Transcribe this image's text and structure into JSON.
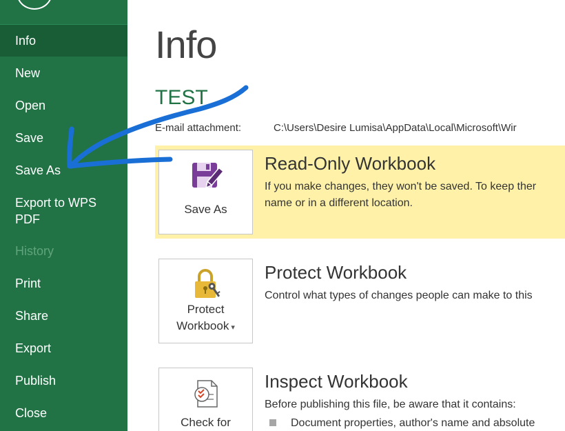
{
  "sidebar": {
    "items": [
      {
        "label": "Info",
        "state": "active"
      },
      {
        "label": "New"
      },
      {
        "label": "Open"
      },
      {
        "label": "Save"
      },
      {
        "label": "Save As"
      },
      {
        "label": "Export to WPS\nPDF"
      },
      {
        "label": "History",
        "state": "disabled"
      },
      {
        "label": "Print"
      },
      {
        "label": "Share"
      },
      {
        "label": "Export"
      },
      {
        "label": "Publish"
      },
      {
        "label": "Close"
      }
    ]
  },
  "main": {
    "title": "Info",
    "document_name": "TEST",
    "attachment": {
      "label": "E-mail attachment:",
      "path": "C:\\Users\\Desire Lumisa\\AppData\\Local\\Microsoft\\Wir"
    },
    "sections": [
      {
        "tile_label": "Save As",
        "icon": "save-as-icon",
        "heading": "Read-Only Workbook",
        "description_lines": [
          "If you make changes, they won't be saved. To keep ther",
          "name or in a different location."
        ]
      },
      {
        "tile_label_lines": [
          "Protect",
          "Workbook"
        ],
        "tile_caret": "▾",
        "icon": "lock-key-icon",
        "heading": "Protect Workbook",
        "description_lines": [
          "Control what types of changes people can make to this"
        ]
      },
      {
        "tile_label_lines": [
          "Check for"
        ],
        "icon": "inspect-document-icon",
        "heading": "Inspect Workbook",
        "description_lines": [
          "Before publishing this file, be aware that it contains:"
        ],
        "bullets": [
          "Document properties, author's name and absolute"
        ]
      }
    ]
  },
  "colors": {
    "sidebar_bg": "#217346",
    "sidebar_active": "#195d36",
    "highlight": "#fff2a8",
    "annotation_arrow": "#1a6fd6"
  }
}
